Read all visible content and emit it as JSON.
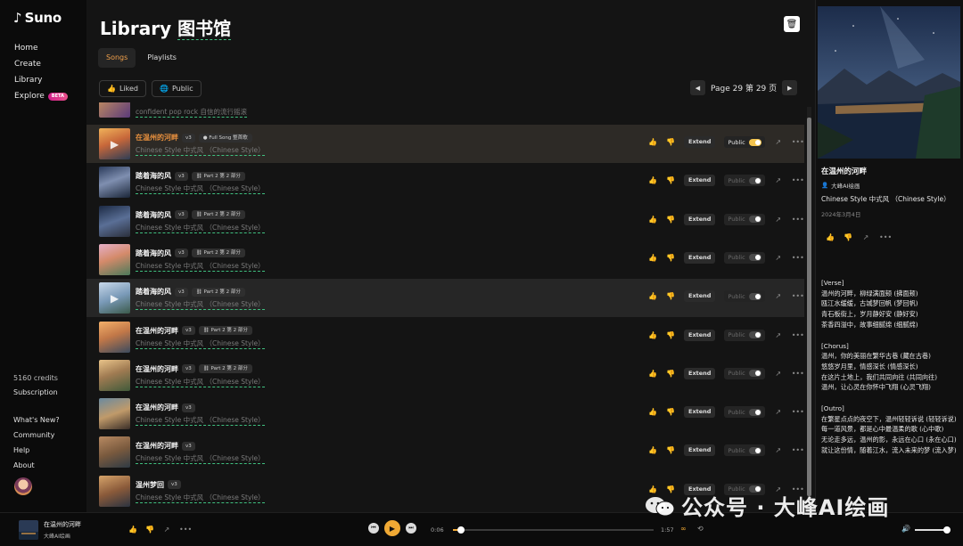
{
  "app": {
    "name": "Suno"
  },
  "sidebar": {
    "items": [
      {
        "label": "Home"
      },
      {
        "label": "Create"
      },
      {
        "label": "Library"
      },
      {
        "label": "Explore",
        "badge": "BETA"
      }
    ],
    "credits": "5160 credits",
    "subscription": "Subscription",
    "links": [
      "What's New?",
      "Community",
      "Help",
      "About"
    ]
  },
  "main": {
    "title_en": "Library",
    "title_cn": "图书馆",
    "tabs": [
      "Songs",
      "Playlists"
    ],
    "active_tab": "Songs",
    "filters": {
      "liked": "Liked",
      "public": "Public"
    },
    "pager": {
      "text": "Page 29 第 29 页"
    },
    "partial_row_style": "confident pop rock 自信的流行摇滚",
    "extend_label": "Extend",
    "public_label": "Public",
    "songs": [
      {
        "title": "在温州的河畔",
        "version": "v3",
        "tag": "Full Song 整首歌",
        "style": "Chinese Style 中式风 （Chinese Style）",
        "public": true,
        "liked": false
      },
      {
        "title": "踏着海的风",
        "version": "v3",
        "tag": "Part 2 第 2 部分",
        "style": "Chinese Style 中式风 （Chinese Style）",
        "public": false,
        "liked": false
      },
      {
        "title": "踏着海的风",
        "version": "v3",
        "tag": "Part 2 第 2 部分",
        "style": "Chinese Style 中式风 （Chinese Style）",
        "public": false,
        "liked": false
      },
      {
        "title": "踏着海的风",
        "version": "v3",
        "tag": "Part 2 第 2 部分",
        "style": "Chinese Style 中式风 （Chinese Style）",
        "public": false,
        "liked": false
      },
      {
        "title": "踏着海的风",
        "version": "v3",
        "tag": "Part 2 第 2 部分",
        "style": "Chinese Style 中式风 （Chinese Style）",
        "public": false,
        "liked": false
      },
      {
        "title": "在温州的河畔",
        "version": "v3",
        "tag": "Part 2 第 2 部分",
        "style": "Chinese Style 中式风 （Chinese Style）",
        "public": false,
        "liked": false
      },
      {
        "title": "在温州的河畔",
        "version": "v3",
        "tag": "Part 2 第 2 部分",
        "style": "Chinese Style 中式风 （Chinese Style）",
        "public": false,
        "liked": false
      },
      {
        "title": "在温州的河畔",
        "version": "v3",
        "tag": "",
        "style": "Chinese Style 中式风 （Chinese Style）",
        "public": false,
        "liked": true
      },
      {
        "title": "在温州的河畔",
        "version": "v3",
        "tag": "",
        "style": "Chinese Style 中式风 （Chinese Style）",
        "public": false,
        "liked": false
      },
      {
        "title": "温州梦回",
        "version": "v3",
        "tag": "",
        "style": "Chinese Style 中式风 （Chinese Style）",
        "public": false,
        "liked": false
      }
    ]
  },
  "panel": {
    "title": "在温州的河畔",
    "artist": "大峰AI绘画",
    "style": "Chinese Style 中式风 （Chinese Style）",
    "date": "2024年3月4日",
    "lyrics": [
      "[Verse]",
      "温州的河畔，柳绿满面颊 (拂面颊)",
      "瓯江水缓缓，古城梦回帆 (梦回帆)",
      "青石板街上，岁月静好安 (静好安)",
      "茶香四溢中，故事细腻绵 (细腻绵)",
      "",
      "[Chorus]",
      "温州，你的美丽在繁华古巷 (藏在古巷)",
      "悠悠岁月里，情感深长 (情感深长)",
      "在这片土地上，我们共同向往 (共同向往)",
      "温州，让心灵在你怀中飞翔 (心灵飞翔)",
      "",
      "[Outro]",
      "在繁星点点的夜空下，温州轻轻诉说 (轻轻诉说)",
      "每一道风景，都是心中最温柔的歌 (心中歌)",
      "无论走多远，温州的影，永远在心口 (永在心口)",
      "就让这份情，随着江水，流入未来的梦 (流入梦)"
    ]
  },
  "player": {
    "title": "在温州的河畔",
    "artist": "大峰AI绘画",
    "current_time": "0:06",
    "total_time": "1:57",
    "progress": 0.04
  },
  "watermark": {
    "text": "公众号 · 大峰AI绘画"
  },
  "colors": {
    "accent": "#f0a934",
    "playing_title": "#e8903e"
  }
}
